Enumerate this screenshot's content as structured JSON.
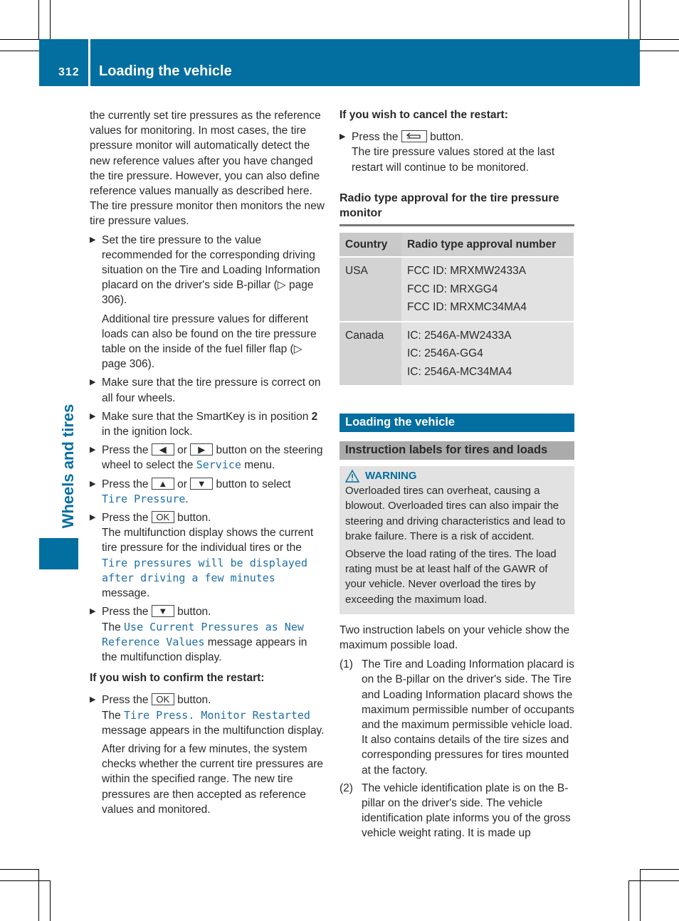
{
  "header": {
    "page_number": "312",
    "title": "Loading the vehicle",
    "accent_color": "#036ea0"
  },
  "side_tab": {
    "label": "Wheels and tires"
  },
  "left_column": {
    "intro": "the currently set tire pressures as the reference values for monitoring. In most cases, the tire pressure monitor will automatically detect the new reference values after you have changed the tire pressure. However, you can also define reference values manually as described here. The tire pressure monitor then monitors the new tire pressure values.",
    "steps": [
      {
        "text": "Set the tire pressure to the value recommended for the corresponding driving situation on the Tire and Loading Information placard on the driver's side B-pillar (▷ page 306).",
        "note": "Additional tire pressure values for different loads can also be found on the tire pressure table on the inside of the fuel filler flap (▷ page 306)."
      },
      {
        "text": "Make sure that the tire pressure is correct on all four wheels."
      },
      {
        "text_a": "Make sure that the SmartKey is in position ",
        "bold": "2",
        "text_b": " in the ignition lock."
      },
      {
        "pre": "Press the ",
        "key1": "◀",
        "mid": " or ",
        "key2": "▶",
        "post": " button on the steering wheel to select the ",
        "display": "Service",
        "end": " menu."
      },
      {
        "pre": "Press the ",
        "key1": "▲",
        "mid": " or ",
        "key2": "▼",
        "post": " button to select ",
        "display": "Tire Pressure",
        "end": "."
      },
      {
        "pre": "Press the ",
        "key": "OK",
        "post": " button.",
        "result_a": "The multifunction display shows the current tire pressure for the individual tires or the ",
        "display": "Tire pressures will be displayed after driving a few minutes",
        "result_b": " message."
      },
      {
        "pre": "Press the ",
        "key": "▼",
        "post": " button.",
        "result_a": "The ",
        "display": "Use Current Pressures as New Reference Values",
        "result_b": " message appears in the multifunction display."
      }
    ],
    "confirm_heading": "If you wish to confirm the restart:",
    "confirm_step": {
      "pre": "Press the ",
      "key": "OK",
      "post": " button.",
      "result_a": "The ",
      "display": "Tire Press. Monitor Restarted",
      "result_b": " message appears in the multifunction display.",
      "note": "After driving for a few minutes, the system checks whether the current tire pressures are within the specified range. The new tire pressures are then accepted as reference values and monitored."
    }
  },
  "right_column": {
    "cancel_heading": "If you wish to cancel the restart:",
    "cancel_step": {
      "pre": "Press the ",
      "key_icon": "back-icon",
      "post": " button.",
      "result": "The tire pressure values stored at the last restart will continue to be monitored."
    },
    "radio_section_title": "Radio type approval for the tire pressure monitor",
    "table": {
      "headers": [
        "Country",
        "Radio type approval number"
      ],
      "rows": [
        {
          "country": "USA",
          "numbers": [
            "FCC ID: MRXMW2433A",
            "FCC ID: MRXGG4",
            "FCC ID: MRXMC34MA4"
          ]
        },
        {
          "country": "Canada",
          "numbers": [
            "IC: 2546A-MW2433A",
            "IC: 2546A-GG4",
            "IC: 2546A-MC34MA4"
          ]
        }
      ]
    },
    "section_band": "Loading the vehicle",
    "subsection_band": "Instruction labels for tires and loads",
    "warning": {
      "title": "WARNING",
      "paragraphs": [
        "Overloaded tires can overheat, causing a blowout. Overloaded tires can also impair the steering and driving characteristics and lead to brake failure. There is a risk of accident.",
        "Observe the load rating of the tires. The load rating must be at least half of the GAWR of your vehicle. Never overload the tires by exceeding the maximum load."
      ]
    },
    "intro": "Two instruction labels on your vehicle show the maximum possible load.",
    "list": [
      {
        "num": "(1)",
        "text": "The Tire and Loading Information placard is on the B-pillar on the driver's side. The Tire and Loading Information placard shows the maximum permissible number of occupants and the maximum permissible vehicle load. It also contains details of the tire sizes and corresponding pressures for tires mounted at the factory."
      },
      {
        "num": "(2)",
        "text": "The vehicle identification plate is on the B-pillar on the driver's side. The vehicle identification plate informs you of the gross vehicle weight rating. It is made up"
      }
    ]
  }
}
